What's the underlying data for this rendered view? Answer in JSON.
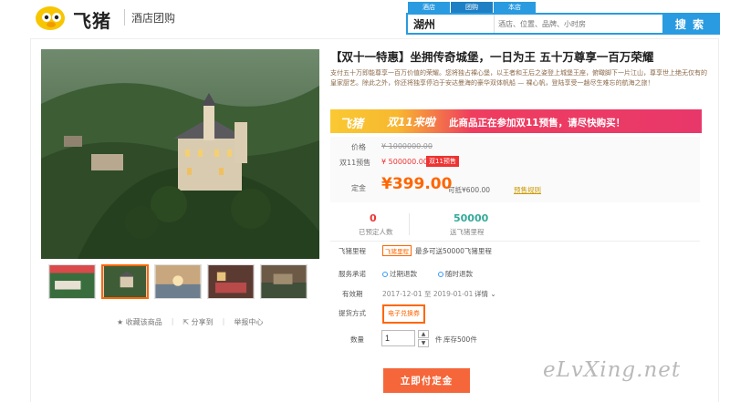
{
  "header": {
    "brand": "飞猪",
    "subtitle": "酒店团购",
    "search_tabs": [
      "酒店",
      "团购",
      "本店"
    ],
    "active_tab": 1,
    "city_value": "湖州",
    "search_placeholder": "酒店、位置、品牌、小时房",
    "search_button": "搜 索"
  },
  "gallery": {
    "actions": [
      "收藏该商品",
      "分享到",
      "举报中心"
    ]
  },
  "product": {
    "title": "【双十一特惠】坐拥传奇城堡，一日为王 五十万尊享一百万荣耀",
    "description": "支付五十万即能尊享一百万价值的荣耀。您将独占裸心堡，以王者和王后之姿登上城堡王座，俯瞰脚下一片江山，尊享世上绝无仅有的皇家厨艺。除此之外，你还将独享停泊于安达曼海的豪华双体帆船 — 裸心帆，登陆享受一趟尽生难忘的航海之旅！",
    "promo": {
      "brand": "飞猪",
      "tag": "双11来啦",
      "text": "此商品正在参加双11预售，请尽快购买！"
    },
    "price_label": "价格",
    "original_price": "¥ 1000000.00",
    "presale_label": "双11预售",
    "presale_price": "¥ 500000.00",
    "presale_badge": "双11预售",
    "deposit_label": "定金",
    "deposit_price": "¥399.00",
    "deposit_note": "可抵¥600.00",
    "rules_link": "预售规则",
    "booked_count": "0",
    "booked_label": "已预定人数",
    "miles_value": "50000",
    "miles_label": "送飞猪里程",
    "mileage_label": "飞猪里程",
    "mileage_tag": "飞猪里程",
    "mileage_text": "最多可送50000飞猪里程",
    "service_label": "服务承诺",
    "service_items": [
      "过期退款",
      "随时退款"
    ],
    "validity_label": "有效期",
    "validity_value": "2017-12-01 至 2019-01-01",
    "validity_detail": "详情",
    "pickup_label": "提货方式",
    "pickup_value": "电子兑换券",
    "qty_label": "数量",
    "qty_value": "1",
    "qty_unit": "件",
    "stock": "库存500件",
    "buy_button": "立即付定金"
  },
  "watermark": "eLvXing.net",
  "colors": {
    "accent": "#2a9be0",
    "price": "#f60",
    "buy": "#f5673a"
  }
}
